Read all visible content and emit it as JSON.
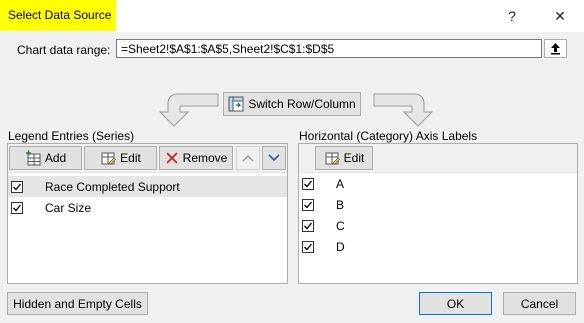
{
  "dialog": {
    "title": "Select Data Source",
    "help_glyph": "?",
    "close_glyph": "✕"
  },
  "range": {
    "label": "Chart data range:",
    "value": "=Sheet2!$A$1:$A$5,Sheet2!$C$1:$D$5"
  },
  "switch_label": "Switch Row/Column",
  "legend": {
    "header": "Legend Entries (Series)",
    "add_label": "Add",
    "edit_label": "Edit",
    "remove_label": "Remove",
    "items": [
      {
        "label": "Race Completed Support",
        "checked": true,
        "selected": true
      },
      {
        "label": "Car Size",
        "checked": true,
        "selected": false
      }
    ]
  },
  "axis": {
    "header": "Horizontal (Category) Axis Labels",
    "edit_label": "Edit",
    "items": [
      {
        "label": "A",
        "checked": true
      },
      {
        "label": "B",
        "checked": true
      },
      {
        "label": "C",
        "checked": true
      },
      {
        "label": "D",
        "checked": true
      }
    ]
  },
  "footer": {
    "hidden_cells_label": "Hidden and Empty Cells",
    "ok_label": "OK",
    "cancel_label": "Cancel"
  },
  "colors": {
    "title_highlight": "#ffff00",
    "accent": "#0078d7",
    "remove_red": "#c42b1c"
  }
}
